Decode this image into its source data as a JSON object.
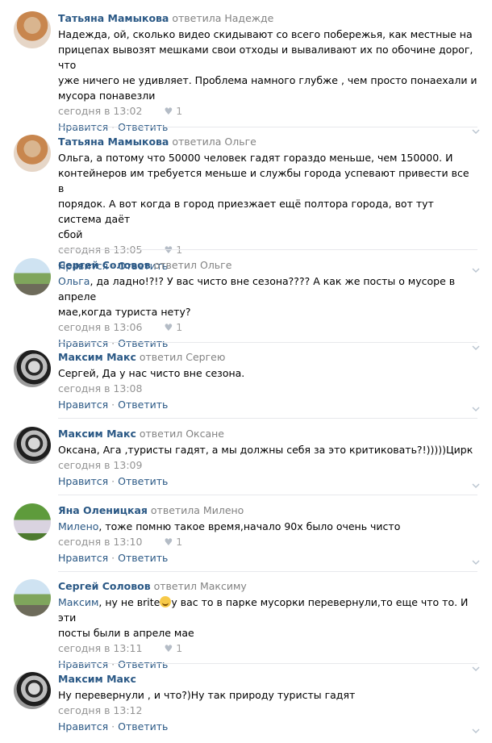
{
  "comments": [
    {
      "author": "Татьяна Мамыкова",
      "reply_to": "ответила Надежде",
      "text_lines": [
        "Надежда, ой, сколько видео скидывают со всего побережья, как местные на",
        "прицепах вывозят мешками свои отходы и вываливают их по обочине дорог, что",
        "уже ничего не удивляет. Проблема намного глубже , чем просто понаехали и",
        "мусора понавезли"
      ],
      "time": "сегодня в 13:02",
      "likes": "1",
      "like_label": "Нравится",
      "reply_label": "Ответить"
    },
    {
      "author": "Татьяна Мамыкова",
      "reply_to": "ответила Ольге",
      "text_lines": [
        "Ольга, а потому что 50000 человек гадят гораздо меньше, чем 150000. И",
        "контейнеров им требуется меньше и службы города успевают привести все в",
        "порядок. А вот когда в город приезжает ещё полтора города, вот тут система даёт",
        "сбой"
      ],
      "time": "сегодня в 13:05",
      "likes": "1",
      "like_label": "Нравится",
      "reply_label": "Ответить"
    },
    {
      "author": "Сергей Соловов",
      "reply_to": "ответил Ольге",
      "mention": "Ольга",
      "text_first_rest": ", да ладно!?!? У вас чисто вне сезона???? А как же посты о мусоре в апреле",
      "text_second": "мае,когда туриста нету?",
      "time": "сегодня в 13:06",
      "likes": "1",
      "like_label": "Нравится",
      "reply_label": "Ответить"
    },
    {
      "author": "Максим Макс",
      "reply_to": "ответил Сергею",
      "text": "Сергей, Да у нас чисто вне сезона.",
      "time": "сегодня в 13:08",
      "like_label": "Нравится",
      "reply_label": "Ответить"
    },
    {
      "author": "Максим Макс",
      "reply_to": "ответил Оксане",
      "text": "Оксана, Ага ,туристы гадят, а мы должны себя за это критиковать?!)))))Цирк",
      "time": "сегодня в 13:09",
      "like_label": "Нравится",
      "reply_label": "Ответить"
    },
    {
      "author": "Яна Оленицкая",
      "reply_to": "ответила Милено",
      "mention": "Милено",
      "text_rest": ", тоже помню такое время,начало 90х было очень чисто",
      "time": "сегодня в 13:10",
      "likes": "1",
      "like_label": "Нравится",
      "reply_label": "Ответить"
    },
    {
      "author": "Сергей Соловов",
      "reply_to": "ответил Максиму",
      "mention": "Максим",
      "text_before_emoji": ", ну не вrite",
      "text_after_emoji": "у вас то в парке мусорки перевернули,то еще что то. И эти",
      "text_second": "посты были в апреле мае",
      "time": "сегодня в 13:11",
      "likes": "1",
      "like_label": "Нравится",
      "reply_label": "Ответить"
    },
    {
      "author": "Максим Макс",
      "reply_to": "",
      "text": "Ну перевернули , и что?)Ну так природу туристы гадят",
      "time": "сегодня в 13:12",
      "like_label": "Нравится",
      "reply_label": "Ответить"
    }
  ]
}
